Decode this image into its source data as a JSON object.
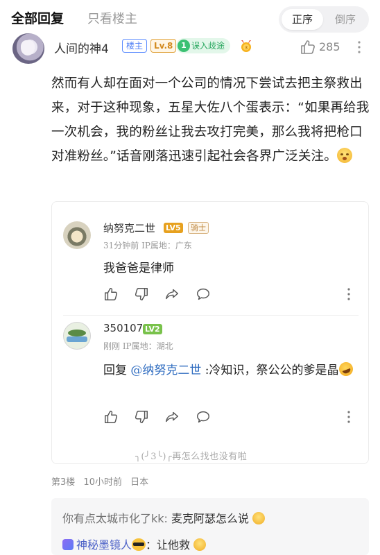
{
  "header": {
    "tab_all": "全部回复",
    "tab_host_only": "只看楼主",
    "order_asc": "正序",
    "order_desc": "倒序"
  },
  "post": {
    "author": "人间的神4",
    "badge_host": "楼主",
    "level": "Lv.8",
    "mark_number": "1",
    "mark_text": "误入歧途",
    "like_count": "285",
    "body": "然而有人却在面对一个公司的情况下尝试去把主祭救出来，对于这种现象，五星大佐八个蛋表示：“如果再给我一次机会，我的粉丝让我去攻打完美，那么我将把枪口对准粉丝。”话音刚落迅速引起社会各界广泛关注。"
  },
  "replies": [
    {
      "name": "纳努克二世",
      "level": "LV5",
      "title_badge": "骑士",
      "meta": "31分钟前  IP属地：广东",
      "text": "我爸爸是律师"
    },
    {
      "name": "350107",
      "level": "LV2",
      "meta": "刚刚  IP属地：湖北",
      "reply_prefix": "回复 ",
      "mention": "@纳努克二世",
      "text": " :冷知识，祭公公的爹是晶"
    }
  ],
  "load_more": "╮(╯3╰)╭再怎么找也没有啦",
  "floor": {
    "number": "第3楼",
    "time": "10小时前",
    "location": "日本"
  },
  "quotes": [
    {
      "author": "你有点太城市化了kk:",
      "text": " 麦克阿瑟怎么说 "
    },
    {
      "author": "神秘墨镜人",
      "text": "：让他救 "
    }
  ]
}
